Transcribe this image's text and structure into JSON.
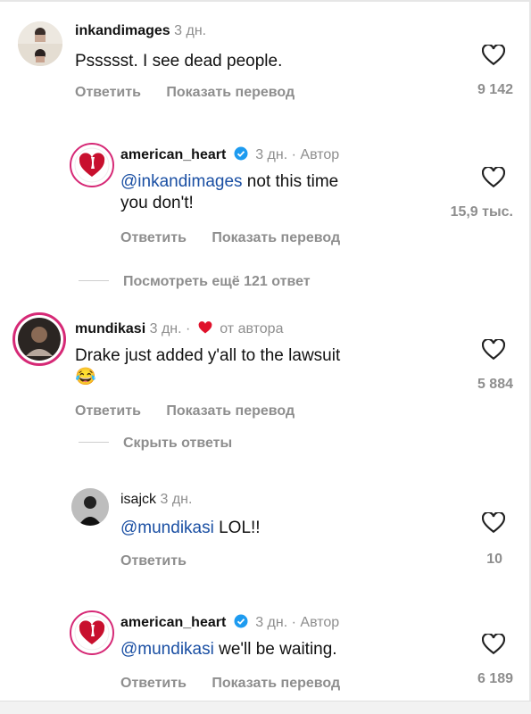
{
  "comments": [
    {
      "username": "inkandimages",
      "time": "3 дн.",
      "text": "Pssssst. I see dead people.",
      "actions": {
        "reply": "Ответить",
        "translate": "Показать перевод"
      },
      "likes": "9 142",
      "avatar_icon": "photo-collage-avatar"
    },
    {
      "username": "american_heart",
      "time": "3 дн.",
      "separator": "·",
      "author_badge": "Автор",
      "mention": "@inkandimages",
      "text_line1": " not this time",
      "text_line2": "you don't!",
      "actions": {
        "reply": "Ответить",
        "translate": "Показать перевод"
      },
      "likes": "15,9 тыс.",
      "avatar_icon": "heart-torch-logo"
    },
    {
      "username": "mundikasi",
      "time": "3 дн.",
      "separator": "·",
      "liked_by": "от автора",
      "text": "Drake just added y'all to the lawsuit",
      "emoji": "😂",
      "actions": {
        "reply": "Ответить",
        "translate": "Показать перевод"
      },
      "likes": "5 884",
      "avatar_icon": "profile-photo-avatar"
    },
    {
      "username": "isajck",
      "time": "3 дн.",
      "mention": "@mundikasi",
      "text": "  LOL!!",
      "actions": {
        "reply": "Ответить"
      },
      "likes": "10",
      "avatar_icon": "profile-photo-avatar"
    },
    {
      "username": "american_heart",
      "time": "3 дн.",
      "separator": "·",
      "author_badge": "Автор",
      "mention": "@mundikasi",
      "text": " we'll be waiting.",
      "actions": {
        "reply": "Ответить",
        "translate": "Показать перевод"
      },
      "likes": "6 189",
      "avatar_icon": "heart-torch-logo"
    }
  ],
  "threads": {
    "view_more": "Посмотреть ещё 121 ответ",
    "hide_replies": "Скрыть ответы"
  },
  "colors": {
    "mention": "#1a4fa3",
    "brand_red": "#c8102e",
    "muted": "#8e8e8e",
    "story_ring": "#d62976"
  }
}
